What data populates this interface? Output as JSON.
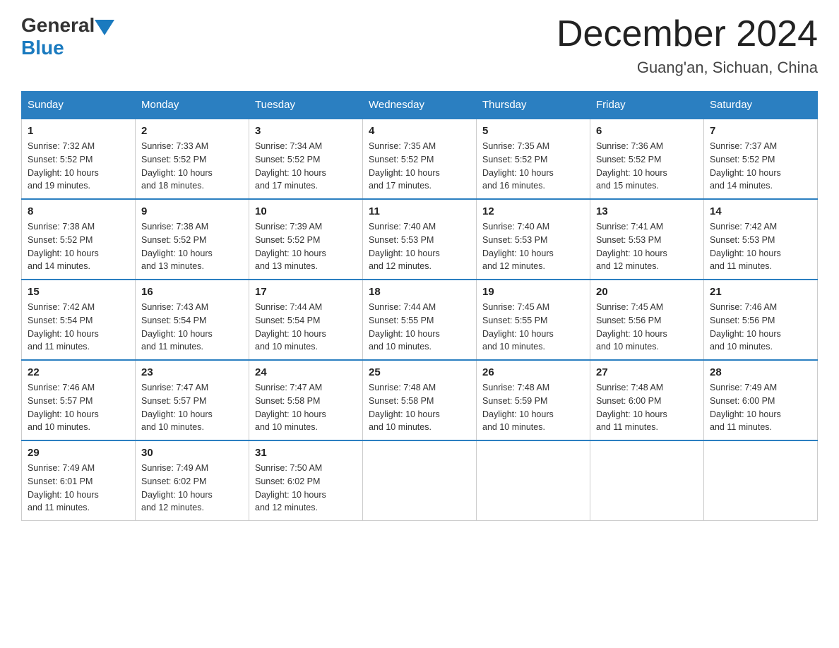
{
  "header": {
    "logo": {
      "text_general": "General",
      "text_blue": "Blue"
    },
    "title": "December 2024",
    "location": "Guang'an, Sichuan, China"
  },
  "days_of_week": [
    "Sunday",
    "Monday",
    "Tuesday",
    "Wednesday",
    "Thursday",
    "Friday",
    "Saturday"
  ],
  "weeks": [
    [
      {
        "day": "1",
        "sunrise": "7:32 AM",
        "sunset": "5:52 PM",
        "daylight": "10 hours and 19 minutes."
      },
      {
        "day": "2",
        "sunrise": "7:33 AM",
        "sunset": "5:52 PM",
        "daylight": "10 hours and 18 minutes."
      },
      {
        "day": "3",
        "sunrise": "7:34 AM",
        "sunset": "5:52 PM",
        "daylight": "10 hours and 17 minutes."
      },
      {
        "day": "4",
        "sunrise": "7:35 AM",
        "sunset": "5:52 PM",
        "daylight": "10 hours and 17 minutes."
      },
      {
        "day": "5",
        "sunrise": "7:35 AM",
        "sunset": "5:52 PM",
        "daylight": "10 hours and 16 minutes."
      },
      {
        "day": "6",
        "sunrise": "7:36 AM",
        "sunset": "5:52 PM",
        "daylight": "10 hours and 15 minutes."
      },
      {
        "day": "7",
        "sunrise": "7:37 AM",
        "sunset": "5:52 PM",
        "daylight": "10 hours and 14 minutes."
      }
    ],
    [
      {
        "day": "8",
        "sunrise": "7:38 AM",
        "sunset": "5:52 PM",
        "daylight": "10 hours and 14 minutes."
      },
      {
        "day": "9",
        "sunrise": "7:38 AM",
        "sunset": "5:52 PM",
        "daylight": "10 hours and 13 minutes."
      },
      {
        "day": "10",
        "sunrise": "7:39 AM",
        "sunset": "5:52 PM",
        "daylight": "10 hours and 13 minutes."
      },
      {
        "day": "11",
        "sunrise": "7:40 AM",
        "sunset": "5:53 PM",
        "daylight": "10 hours and 12 minutes."
      },
      {
        "day": "12",
        "sunrise": "7:40 AM",
        "sunset": "5:53 PM",
        "daylight": "10 hours and 12 minutes."
      },
      {
        "day": "13",
        "sunrise": "7:41 AM",
        "sunset": "5:53 PM",
        "daylight": "10 hours and 12 minutes."
      },
      {
        "day": "14",
        "sunrise": "7:42 AM",
        "sunset": "5:53 PM",
        "daylight": "10 hours and 11 minutes."
      }
    ],
    [
      {
        "day": "15",
        "sunrise": "7:42 AM",
        "sunset": "5:54 PM",
        "daylight": "10 hours and 11 minutes."
      },
      {
        "day": "16",
        "sunrise": "7:43 AM",
        "sunset": "5:54 PM",
        "daylight": "10 hours and 11 minutes."
      },
      {
        "day": "17",
        "sunrise": "7:44 AM",
        "sunset": "5:54 PM",
        "daylight": "10 hours and 10 minutes."
      },
      {
        "day": "18",
        "sunrise": "7:44 AM",
        "sunset": "5:55 PM",
        "daylight": "10 hours and 10 minutes."
      },
      {
        "day": "19",
        "sunrise": "7:45 AM",
        "sunset": "5:55 PM",
        "daylight": "10 hours and 10 minutes."
      },
      {
        "day": "20",
        "sunrise": "7:45 AM",
        "sunset": "5:56 PM",
        "daylight": "10 hours and 10 minutes."
      },
      {
        "day": "21",
        "sunrise": "7:46 AM",
        "sunset": "5:56 PM",
        "daylight": "10 hours and 10 minutes."
      }
    ],
    [
      {
        "day": "22",
        "sunrise": "7:46 AM",
        "sunset": "5:57 PM",
        "daylight": "10 hours and 10 minutes."
      },
      {
        "day": "23",
        "sunrise": "7:47 AM",
        "sunset": "5:57 PM",
        "daylight": "10 hours and 10 minutes."
      },
      {
        "day": "24",
        "sunrise": "7:47 AM",
        "sunset": "5:58 PM",
        "daylight": "10 hours and 10 minutes."
      },
      {
        "day": "25",
        "sunrise": "7:48 AM",
        "sunset": "5:58 PM",
        "daylight": "10 hours and 10 minutes."
      },
      {
        "day": "26",
        "sunrise": "7:48 AM",
        "sunset": "5:59 PM",
        "daylight": "10 hours and 10 minutes."
      },
      {
        "day": "27",
        "sunrise": "7:48 AM",
        "sunset": "6:00 PM",
        "daylight": "10 hours and 11 minutes."
      },
      {
        "day": "28",
        "sunrise": "7:49 AM",
        "sunset": "6:00 PM",
        "daylight": "10 hours and 11 minutes."
      }
    ],
    [
      {
        "day": "29",
        "sunrise": "7:49 AM",
        "sunset": "6:01 PM",
        "daylight": "10 hours and 11 minutes."
      },
      {
        "day": "30",
        "sunrise": "7:49 AM",
        "sunset": "6:02 PM",
        "daylight": "10 hours and 12 minutes."
      },
      {
        "day": "31",
        "sunrise": "7:50 AM",
        "sunset": "6:02 PM",
        "daylight": "10 hours and 12 minutes."
      },
      null,
      null,
      null,
      null
    ]
  ],
  "labels": {
    "sunrise": "Sunrise:",
    "sunset": "Sunset:",
    "daylight": "Daylight:"
  }
}
